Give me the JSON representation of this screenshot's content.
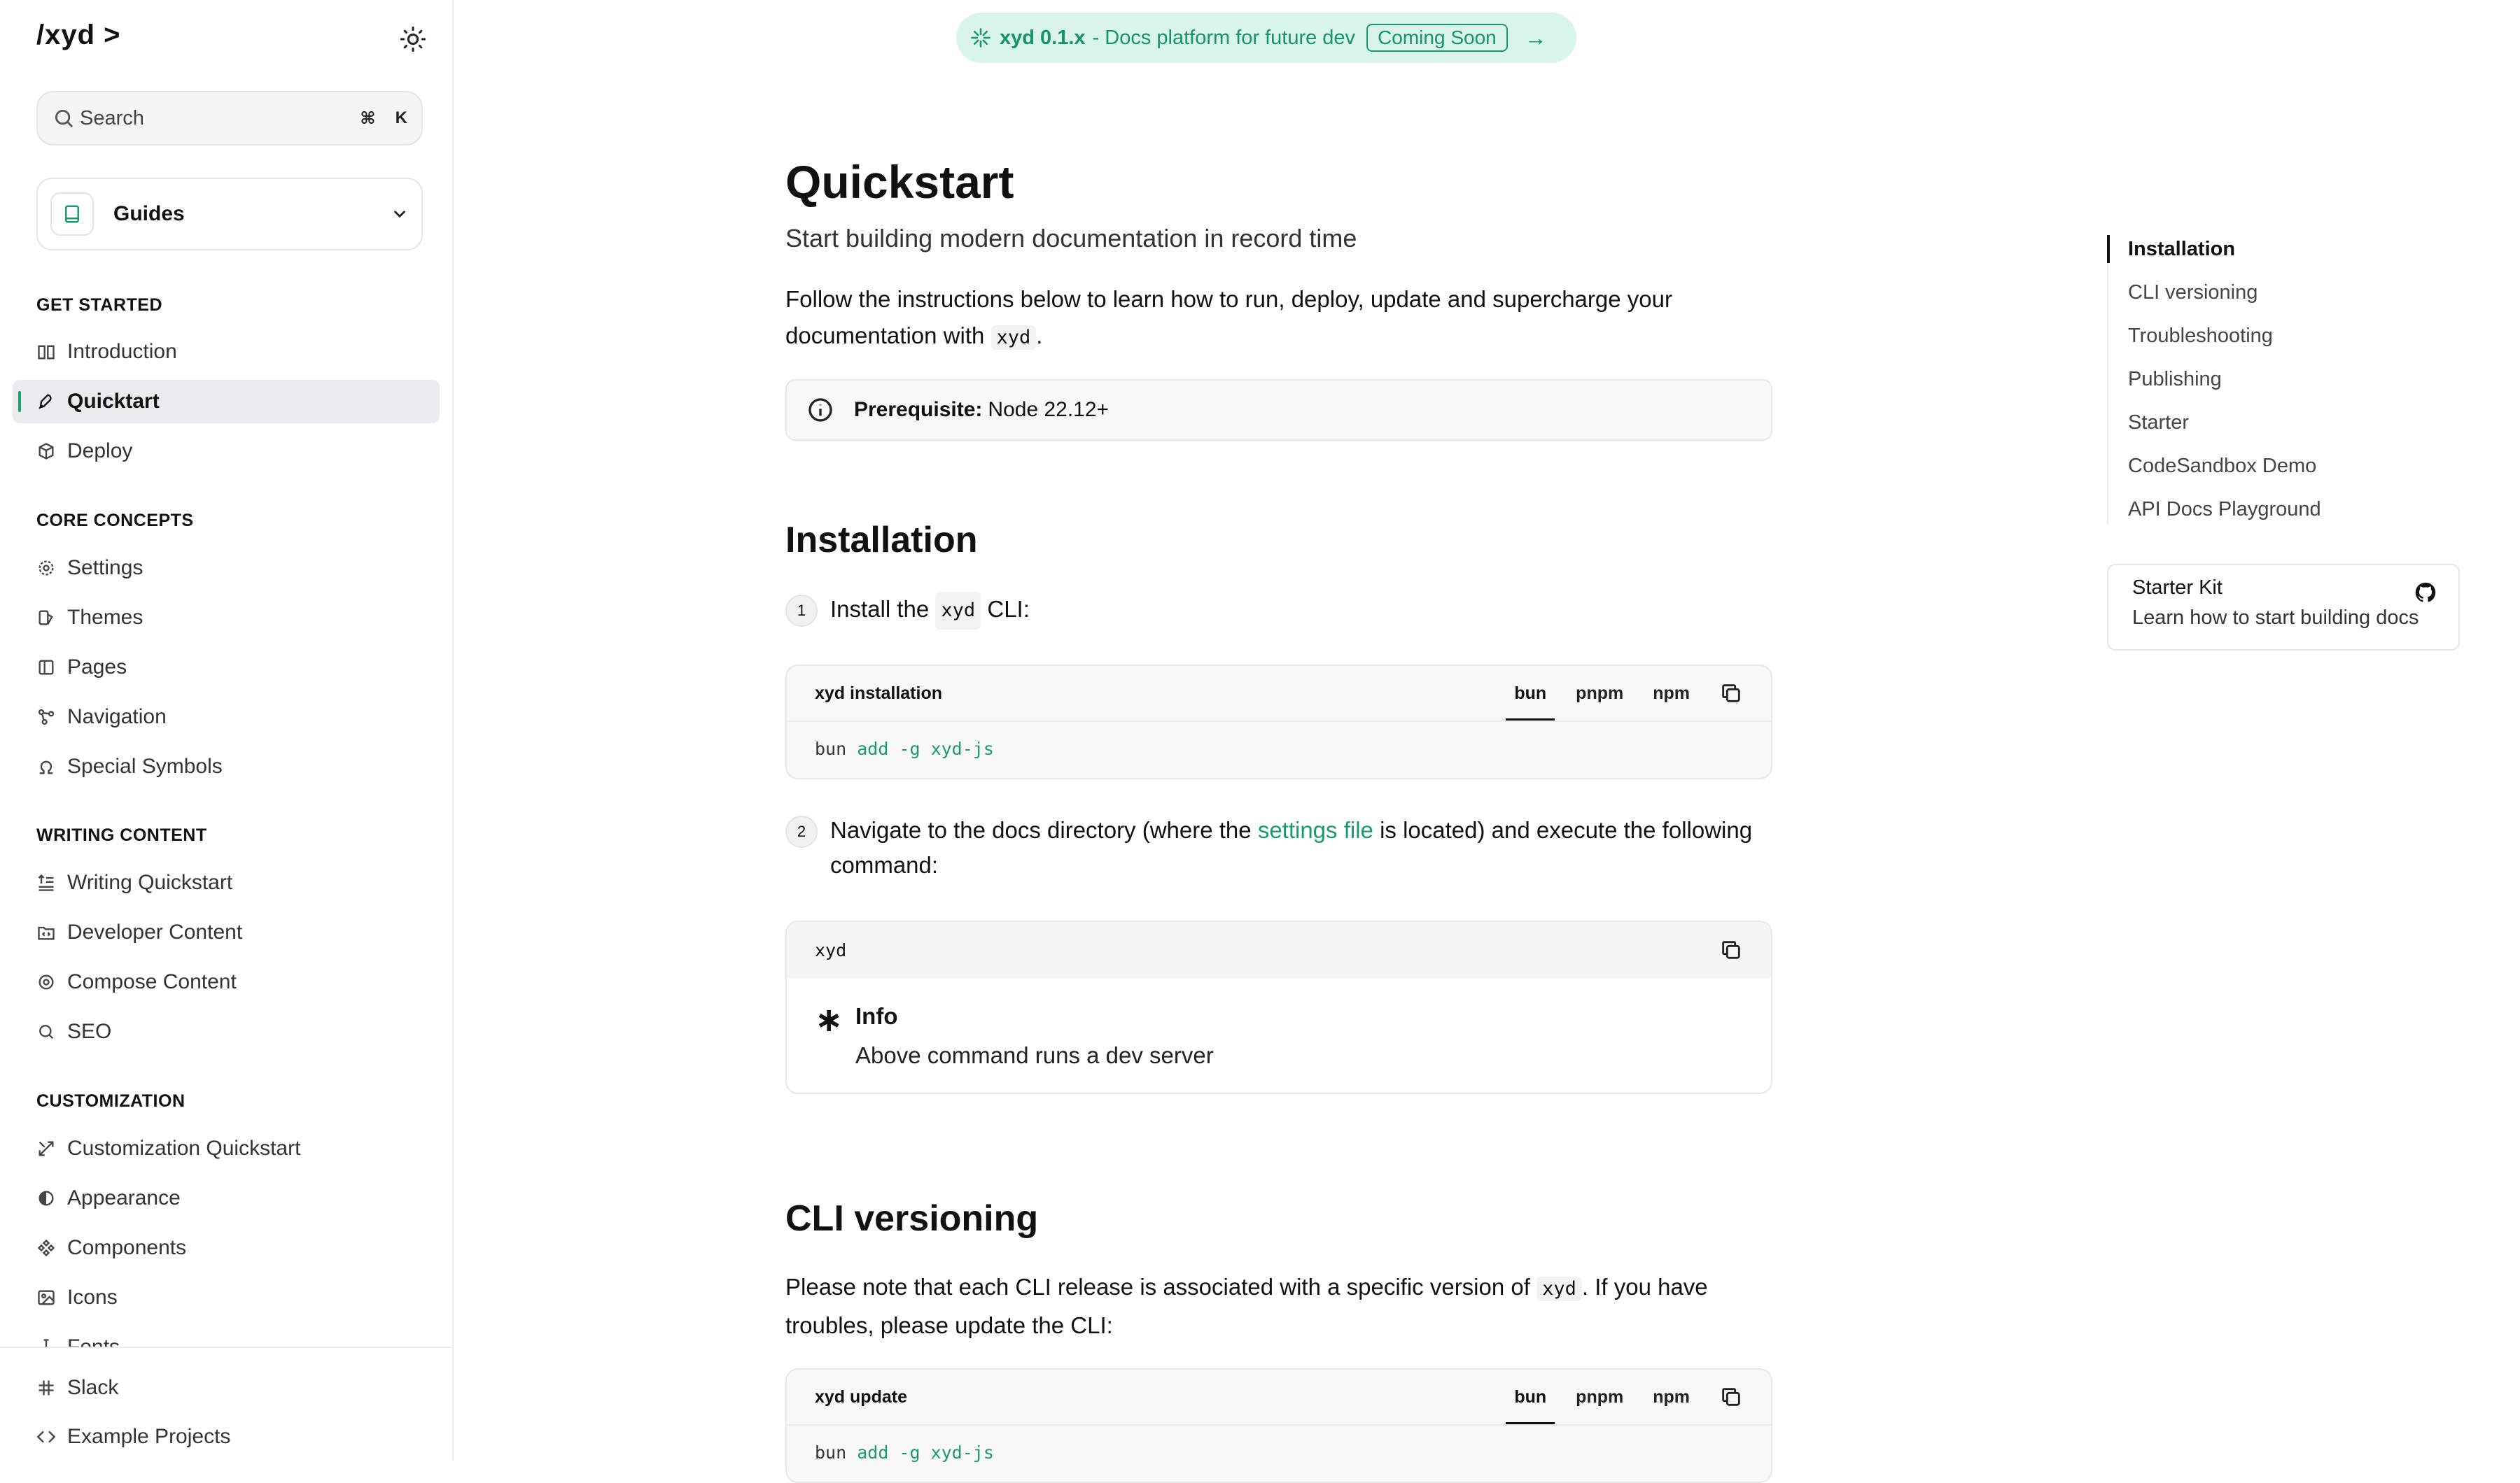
{
  "brand": {
    "logo": "/xyd >"
  },
  "search": {
    "label": "Search",
    "shortcut_mod": "⌘",
    "shortcut_key": "K"
  },
  "switcher": {
    "label": "Guides"
  },
  "sidebar": {
    "sections": [
      {
        "title": "GET STARTED",
        "items": [
          {
            "label": "Introduction",
            "icon": "book-open-icon"
          },
          {
            "label": "Quicktart",
            "icon": "rocket-icon",
            "active": true
          },
          {
            "label": "Deploy",
            "icon": "cube-icon"
          }
        ]
      },
      {
        "title": "CORE CONCEPTS",
        "items": [
          {
            "label": "Settings",
            "icon": "gear-icon"
          },
          {
            "label": "Themes",
            "icon": "palette-icon"
          },
          {
            "label": "Pages",
            "icon": "book-icon"
          },
          {
            "label": "Navigation",
            "icon": "network-icon"
          },
          {
            "label": "Special Symbols",
            "icon": "omega-icon"
          }
        ]
      },
      {
        "title": "WRITING CONTENT",
        "items": [
          {
            "label": "Writing Quickstart",
            "icon": "text-icon"
          },
          {
            "label": "Developer Content",
            "icon": "folder-code-icon"
          },
          {
            "label": "Compose Content",
            "icon": "compose-icon"
          },
          {
            "label": "SEO",
            "icon": "search-icon"
          }
        ]
      },
      {
        "title": "CUSTOMIZATION",
        "items": [
          {
            "label": "Customization Quickstart",
            "icon": "tools-icon"
          },
          {
            "label": "Appearance",
            "icon": "contrast-icon"
          },
          {
            "label": "Components",
            "icon": "components-icon"
          },
          {
            "label": "Icons",
            "icon": "image-icon"
          },
          {
            "label": "Fonts",
            "icon": "text-cursor-icon"
          }
        ]
      }
    ],
    "bottom": [
      {
        "label": "Slack",
        "icon": "slack-icon"
      },
      {
        "label": "Example Projects",
        "icon": "code-icon"
      }
    ]
  },
  "banner": {
    "version": "xyd 0.1.x",
    "text": "- Docs platform for future dev",
    "badge": "Coming Soon"
  },
  "main": {
    "title": "Quickstart",
    "subtitle": "Start building modern documentation in record time",
    "intro_before": "Follow the instructions below to learn how to run, deploy, update and supercharge your documentation with",
    "intro_code": "xyd",
    "intro_after": ".",
    "prereq_label": "Prerequisite:",
    "prereq_value": "Node 22.12+",
    "installation": {
      "heading": "Installation",
      "step1_num": "1",
      "step1_before": "Install the",
      "step1_code": "xyd",
      "step1_after": "CLI:",
      "code1": {
        "title": "xyd installation",
        "tabs": [
          "bun",
          "pnpm",
          "npm"
        ],
        "cmd": "bun",
        "args": "add -g xyd-js"
      },
      "step2_num": "2",
      "step2_before": "Navigate to the docs directory (where the",
      "step2_link": "settings file",
      "step2_after": "is located) and execute the following command:",
      "code2": {
        "cmd": "xyd"
      },
      "info_title": "Info",
      "info_text": "Above command runs a dev server"
    },
    "versioning": {
      "heading": "CLI versioning",
      "text_before": "Please note that each CLI release is associated with a specific version of",
      "text_code": "xyd",
      "text_after": ". If you have troubles, please update the CLI:",
      "code": {
        "title": "xyd update",
        "tabs": [
          "bun",
          "pnpm",
          "npm"
        ],
        "cmd": "bun",
        "args": "add -g xyd-js"
      }
    }
  },
  "toc": {
    "items": [
      "Installation",
      "CLI versioning",
      "Troubleshooting",
      "Publishing",
      "Starter",
      "CodeSandbox Demo",
      "API Docs Playground"
    ],
    "active_index": 0
  },
  "starter_card": {
    "title": "Starter Kit",
    "description": "Learn how to start building docs"
  },
  "colors": {
    "accent": "#1a9a70",
    "banner_bg": "#d9f5ea",
    "active_bg": "#ebebed"
  }
}
